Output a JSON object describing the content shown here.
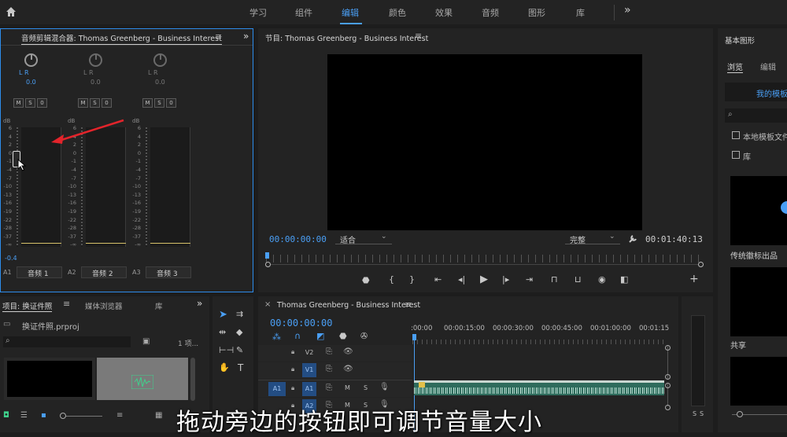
{
  "topbar": {
    "tabs": [
      "学习",
      "组件",
      "编辑",
      "颜色",
      "效果",
      "音频",
      "图形",
      "库"
    ],
    "active": "编辑",
    "more": "»"
  },
  "mixer": {
    "title": "音频剪辑混合器: Thomas Greenberg - Business Interest",
    "more": "»",
    "db_label": "dB",
    "ticks": [
      "6",
      "4",
      "2",
      "0",
      "-1",
      "-4",
      "-7",
      "-10",
      "-13",
      "-16",
      "-19",
      "-22",
      "-28",
      "-37",
      "-∞"
    ],
    "channels": [
      {
        "lr": "L    R",
        "value": "0.0",
        "msn": [
          "M",
          "S",
          "0"
        ],
        "id": "A1",
        "name": "音频 1",
        "level": "-0.4"
      },
      {
        "lr": "L    R",
        "value": "0.0",
        "msn": [
          "M",
          "S",
          "0"
        ],
        "id": "A2",
        "name": "音频 2"
      },
      {
        "lr": "L    R",
        "value": "0.0",
        "msn": [
          "M",
          "S",
          "0"
        ],
        "id": "A3",
        "name": "音频 3"
      }
    ]
  },
  "program": {
    "title": "节目: Thomas Greenberg - Business Interest",
    "timecode": "00:00:00:00",
    "fit": "适合",
    "quality": "完整",
    "duration": "00:01:40:13"
  },
  "basic_graphics": {
    "title": "基本图形",
    "tabs": [
      "浏览",
      "编辑"
    ],
    "my_templates": "我的模板",
    "check1": "本地模板文件夹",
    "check2": "库",
    "item1": "传统徽标出品",
    "item2": "共享"
  },
  "project": {
    "tabs": [
      "项目: 换证件照",
      "媒体浏览器",
      "库"
    ],
    "more": "»",
    "file": "换证件照.prproj",
    "count": "1 项..."
  },
  "timeline": {
    "title": "Thomas Greenberg - Business Interest",
    "timecode": "00:00:00:00",
    "ruler": [
      ":00:00",
      "00:00:15:00",
      "00:00:30:00",
      "00:00:45:00",
      "00:01:00:00",
      "00:01:15"
    ],
    "tracks": [
      "V2",
      "V1",
      "A1",
      "A2"
    ],
    "src": "A1",
    "m": "M",
    "s": "S"
  },
  "meter": {
    "labels": [
      "S",
      "S"
    ]
  },
  "subtitle": "拖动旁边的按钮即可调节音量大小",
  "colors": {
    "accent": "#4a9ff5",
    "clip": "#2e6b5c",
    "track_blue": "#234d83",
    "arrow": "#e3242b"
  }
}
